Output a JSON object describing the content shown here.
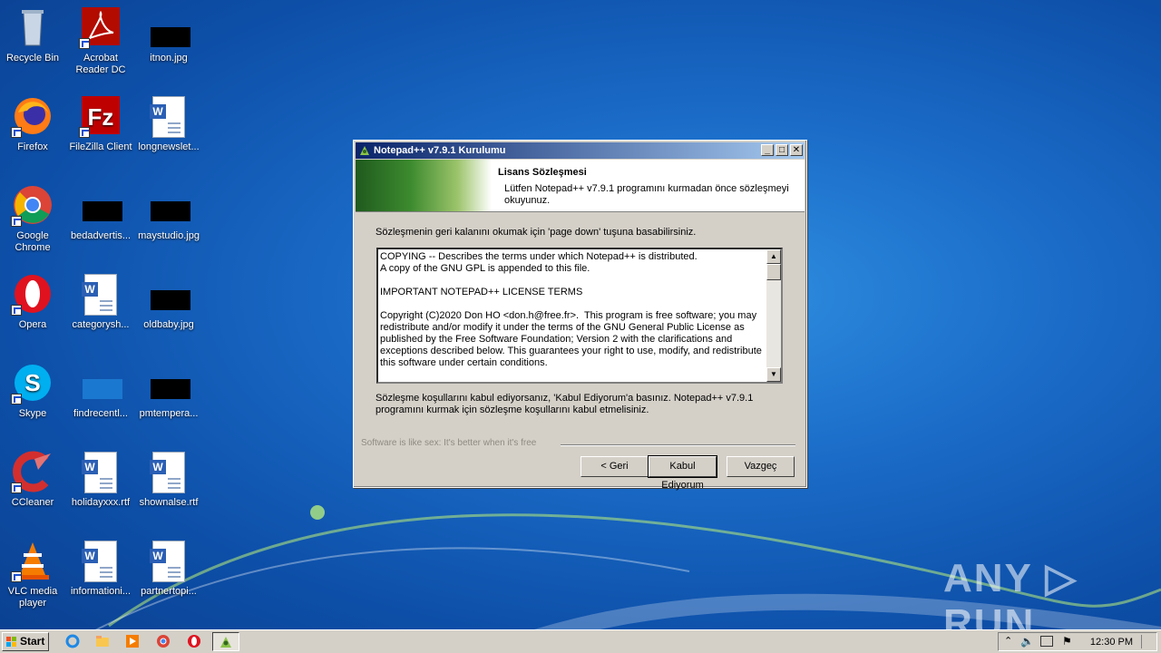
{
  "desktop": {
    "icons": [
      {
        "label": "Recycle Bin",
        "icon": "recycle-bin-icon"
      },
      {
        "label": "Acrobat Reader DC",
        "icon": "acrobat-reader-icon"
      },
      {
        "label": "itnon.jpg",
        "icon": "image-file-icon"
      },
      {
        "label": "Firefox",
        "icon": "firefox-icon"
      },
      {
        "label": "FileZilla Client",
        "icon": "filezilla-icon"
      },
      {
        "label": "longnewslet...",
        "icon": "word-document-icon"
      },
      {
        "label": "Google Chrome",
        "icon": "chrome-icon"
      },
      {
        "label": "bedadvertis...",
        "icon": "file-icon"
      },
      {
        "label": "maystudio.jpg",
        "icon": "image-file-icon"
      },
      {
        "label": "Opera",
        "icon": "opera-icon"
      },
      {
        "label": "categorysh...",
        "icon": "word-document-icon"
      },
      {
        "label": "oldbaby.jpg",
        "icon": "image-file-icon"
      },
      {
        "label": "Skype",
        "icon": "skype-icon"
      },
      {
        "label": "findrecentl...",
        "icon": "file-icon"
      },
      {
        "label": "pmtempera...",
        "icon": "image-file-icon"
      },
      {
        "label": "CCleaner",
        "icon": "ccleaner-icon"
      },
      {
        "label": "holidayxxx.rtf",
        "icon": "word-document-icon"
      },
      {
        "label": "shownalse.rtf",
        "icon": "word-document-icon"
      },
      {
        "label": "VLC media player",
        "icon": "vlc-icon"
      },
      {
        "label": "informationi...",
        "icon": "word-document-icon"
      },
      {
        "label": "partnertopi...",
        "icon": "word-document-icon"
      }
    ]
  },
  "dialog": {
    "title": "Notepad++ v7.9.1 Kurulumu",
    "header_title": "Lisans Sözleşmesi",
    "header_subtitle": "Lütfen Notepad++ v7.9.1 programını kurmadan önce sözleşmeyi okuyunuz.",
    "instruction": "Sözleşmenin geri kalanını okumak için 'page down' tuşuna basabilirsiniz.",
    "license_text": "COPYING -- Describes the terms under which Notepad++ is distributed.\nA copy of the GNU GPL is appended to this file.\n\nIMPORTANT NOTEPAD++ LICENSE TERMS\n\nCopyright (C)2020 Don HO <don.h@free.fr>.  This program is free software; you may redistribute and/or modify it under the terms of the GNU General Public License as published by the Free Software Foundation; Version 2 with the clarifications and exceptions described below. This guarantees your right to use, modify, and redistribute this software under certain conditions.",
    "agree_text": "Sözleşme koşullarını kabul ediyorsanız, 'Kabul Ediyorum'a basınız. Notepad++ v7.9.1 programını kurmak için sözleşme koşullarını kabul etmelisiniz.",
    "branding": "Software is like sex: It's better when it's free",
    "buttons": {
      "back": "< Geri",
      "accept": "Kabul Ediyorum",
      "cancel": "Vazgeç"
    },
    "title_buttons": {
      "minimize": "_",
      "maximize": "□",
      "close": "✕"
    }
  },
  "taskbar": {
    "start_label": "Start",
    "clock": "12:30 PM"
  },
  "watermark": "ANY ▷ RUN"
}
